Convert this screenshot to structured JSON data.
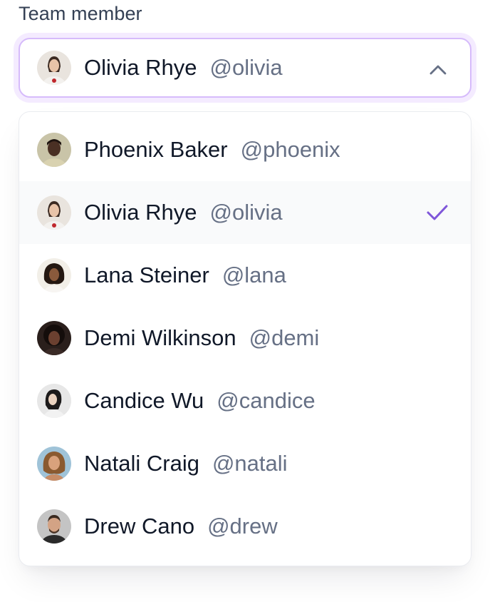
{
  "field": {
    "label": "Team member"
  },
  "selected": {
    "name": "Olivia Rhye",
    "handle": "@olivia",
    "avatar": "avatar-olivia"
  },
  "dropdown_open": true,
  "options": [
    {
      "name": "Phoenix Baker",
      "handle": "@phoenix",
      "avatar": "avatar-phoenix",
      "selected": false
    },
    {
      "name": "Olivia Rhye",
      "handle": "@olivia",
      "avatar": "avatar-olivia",
      "selected": true
    },
    {
      "name": "Lana Steiner",
      "handle": "@lana",
      "avatar": "avatar-lana",
      "selected": false
    },
    {
      "name": "Demi Wilkinson",
      "handle": "@demi",
      "avatar": "avatar-demi",
      "selected": false
    },
    {
      "name": "Candice Wu",
      "handle": "@candice",
      "avatar": "avatar-candice",
      "selected": false
    },
    {
      "name": "Natali Craig",
      "handle": "@natali",
      "avatar": "avatar-natali",
      "selected": false
    },
    {
      "name": "Drew Cano",
      "handle": "@drew",
      "avatar": "avatar-drew",
      "selected": false
    }
  ],
  "icons": {
    "trigger": "chevron-up-icon",
    "selected_marker": "check-icon"
  },
  "colors": {
    "focus_border": "#d6bbfb",
    "focus_ring": "#f4ebff",
    "check": "#7f56d9",
    "selected_row_bg": "#f9fafb",
    "name_text": "#101828",
    "handle_text": "#667085",
    "label_text": "#344054"
  }
}
